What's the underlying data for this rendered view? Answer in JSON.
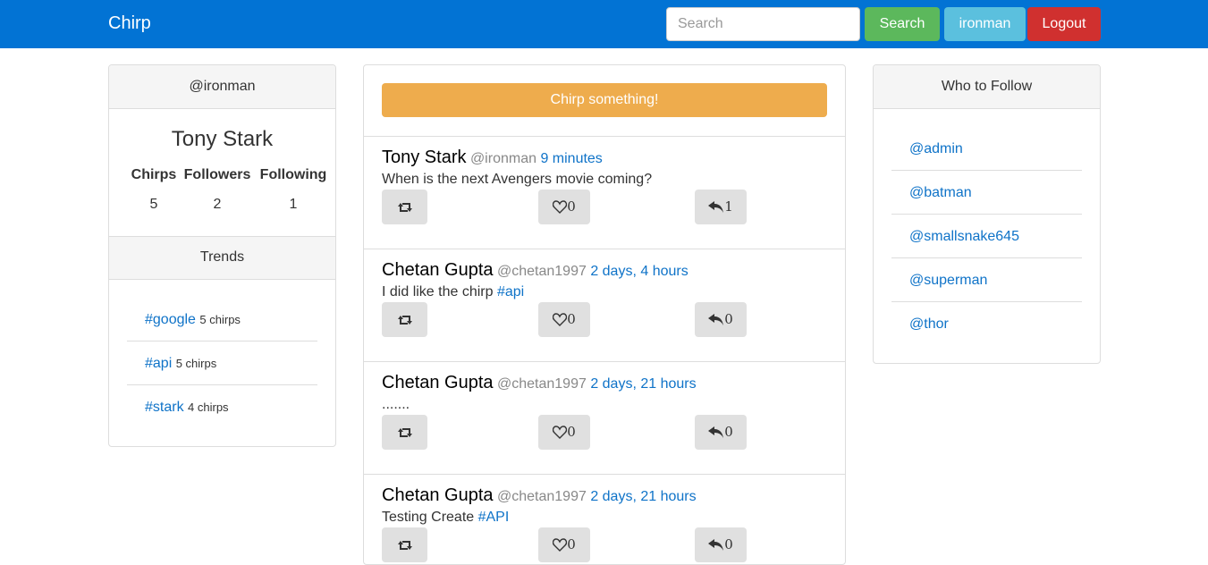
{
  "navbar": {
    "brand": "Chirp",
    "search_placeholder": "Search",
    "search_button": "Search",
    "user_button": "ironman",
    "logout_button": "Logout"
  },
  "profile": {
    "handle": "@ironman",
    "name": "Tony Stark",
    "stats": [
      {
        "label": "Chirps",
        "value": "5"
      },
      {
        "label": "Followers",
        "value": "2"
      },
      {
        "label": "Following",
        "value": "1"
      }
    ]
  },
  "trends": {
    "heading": "Trends",
    "items": [
      {
        "tag": "#google",
        "count": "5 chirps"
      },
      {
        "tag": "#api",
        "count": "5 chirps"
      },
      {
        "tag": "#stark",
        "count": "4 chirps"
      }
    ]
  },
  "feed": {
    "compose_button": "Chirp something!",
    "posts": [
      {
        "name": "Tony Stark",
        "handle": "@ironman",
        "time": "9 minutes",
        "text": "When is the next Avengers movie coming?",
        "hashtag": "",
        "likes": "0",
        "replies": "1"
      },
      {
        "name": "Chetan Gupta",
        "handle": "@chetan1997",
        "time": "2 days, 4 hours",
        "text": "I did like the chirp ",
        "hashtag": "#api",
        "likes": "0",
        "replies": "0"
      },
      {
        "name": "Chetan Gupta",
        "handle": "@chetan1997",
        "time": "2 days, 21 hours",
        "text": ".......",
        "hashtag": "",
        "likes": "0",
        "replies": "0"
      },
      {
        "name": "Chetan Gupta",
        "handle": "@chetan1997",
        "time": "2 days, 21 hours",
        "text": "Testing Create ",
        "hashtag": "#API",
        "likes": "0",
        "replies": "0"
      }
    ]
  },
  "who_to_follow": {
    "heading": "Who to Follow",
    "users": [
      "@admin",
      "@batman",
      "@smallsnake645",
      "@superman",
      "@thor"
    ]
  },
  "icons": {
    "rechirp": "retweet-icon",
    "like": "heart-icon",
    "reply": "reply-icon"
  },
  "colors": {
    "navbar": "#0273d4",
    "search_button": "#5cb85c",
    "user_button": "#5bc0de",
    "logout_button": "#d0302f",
    "compose_button": "#eeac4d",
    "link": "#0f73c8"
  }
}
